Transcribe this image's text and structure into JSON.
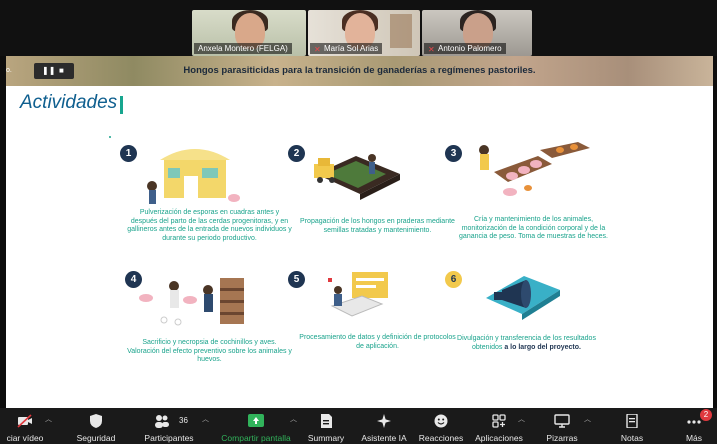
{
  "participants": [
    {
      "name": "Anxela Montero (FELGA)",
      "muted": false
    },
    {
      "name": "María Sol Arias",
      "muted": true
    },
    {
      "name": "Antonio Palomero",
      "muted": true
    }
  ],
  "share": {
    "control_label": "o.",
    "pause_icon": "pause-icon",
    "stop_icon": "stop-icon",
    "banner_title": "Hongos parasiticidas para la transición de ganaderías a regímenes pastoriles.",
    "slide_title": "Actividades",
    "activities": [
      {
        "number": "1",
        "caption": "Pulverización de esporas en cuadras antes y después del parto de las cerdas progenitoras, y en gallineros antes de la entrada de nuevos individuos y durante su periodo productivo."
      },
      {
        "number": "2",
        "caption": "Propagación de los hongos en praderas mediante semillas tratadas y mantenimiento."
      },
      {
        "number": "3",
        "caption": "Cría y mantenimiento de los animales, monitorización de la condición corporal y de la ganancia de peso. Toma de muestras de heces."
      },
      {
        "number": "4",
        "caption": "Sacrificio y necropsia de cochinillos y aves. Valoración del efecto preventivo sobre los animales y huevos."
      },
      {
        "number": "5",
        "caption": "Procesamiento de datos y definición de protocolos de aplicación."
      },
      {
        "number": "6",
        "caption": "Divulgación y transferencia de los resultados obtenidos",
        "caption_bold": "a lo largo del proyecto."
      }
    ]
  },
  "toolbar": {
    "video_label": "ciar vídeo",
    "security_label": "Seguridad",
    "participants_label": "Participantes",
    "participants_count": "36",
    "share_label": "Compartir pantalla",
    "summary_label": "Summary",
    "ai_label": "Asistente IA",
    "reactions_label": "Reacciones",
    "apps_label": "Aplicaciones",
    "whiteboards_label": "Pizarras",
    "notes_label": "Notas",
    "more_label": "Más",
    "more_badge": "2",
    "colors": {
      "share_green": "#31b35b",
      "badge_red": "#e0393e",
      "muted_red": "#e5484d"
    }
  }
}
